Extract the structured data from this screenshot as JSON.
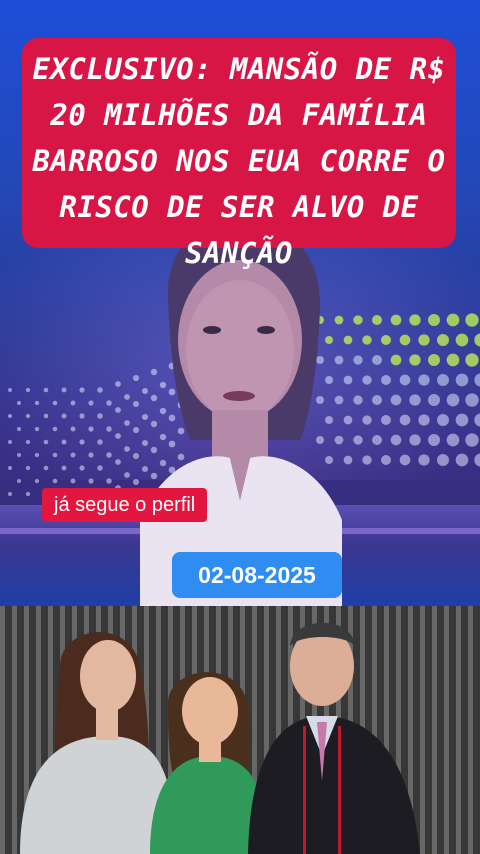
{
  "headline": {
    "text": "EXCLUSIVO: MANSÃO DE R$ 20 MILHÕES DA FAMÍLIA BARROSO NOS EUA CORRE O RISCO DE SER ALVO DE SANÇÃO",
    "background_color": "#d81646"
  },
  "tag": {
    "label": "já segue o perfil",
    "background_color": "#e2163f"
  },
  "date": {
    "label": "02-08-2025",
    "background_color": "#2f8df2"
  },
  "colors": {
    "studio_blue": "#1e4ed8",
    "studio_purple": "#3a2f86",
    "dot_lime": "#b6e35a",
    "dot_white": "#dfe6ff"
  },
  "icons": [
    "presenter-figure",
    "family-photo"
  ]
}
